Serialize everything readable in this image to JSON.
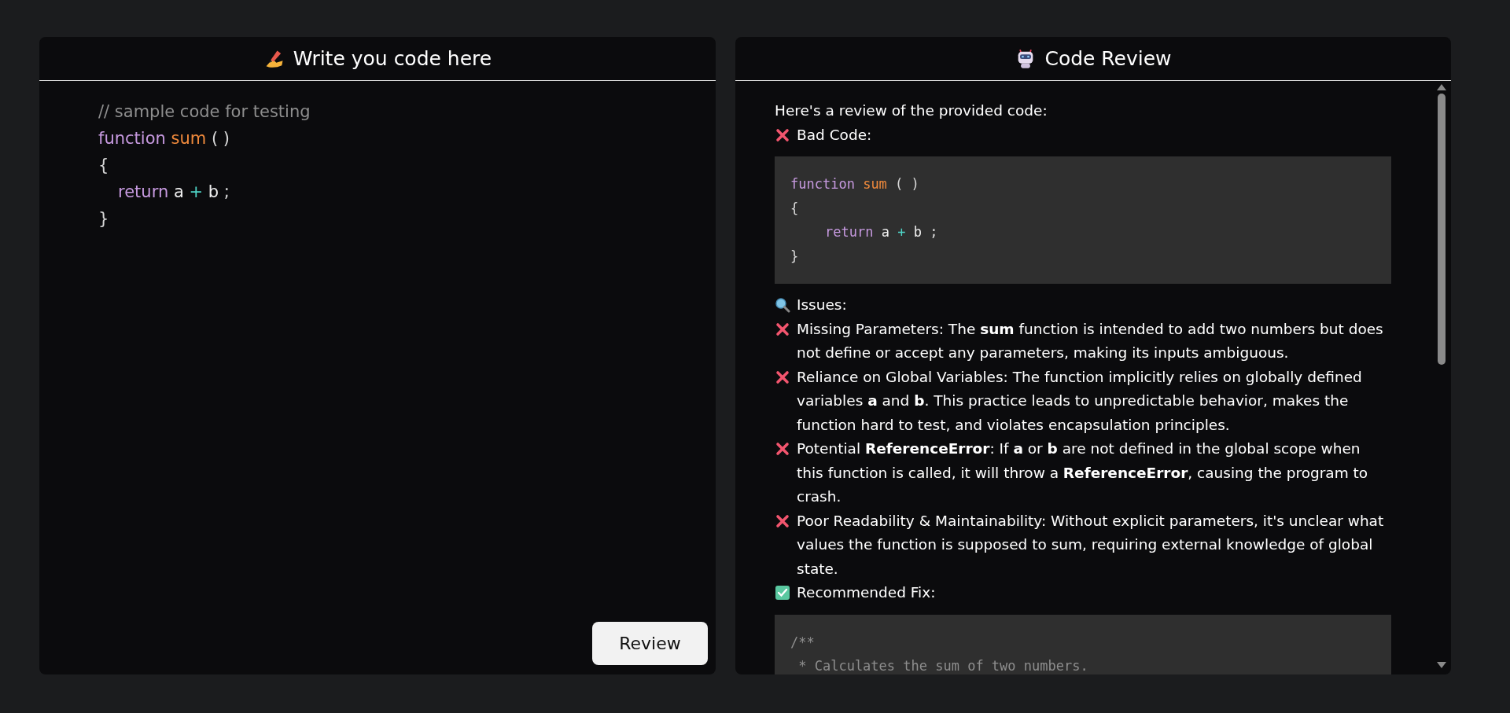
{
  "editor": {
    "title": "Write you code here",
    "lines": [
      {
        "indented": false,
        "tokens": [
          {
            "text": "// sample code for testing",
            "kind": "comment"
          }
        ]
      },
      {
        "indented": false,
        "tokens": [
          {
            "text": "function",
            "kind": "keyword"
          },
          {
            "text": "sum",
            "kind": "function"
          },
          {
            "text": "( )",
            "kind": "punct"
          }
        ]
      },
      {
        "indented": false,
        "tokens": [
          {
            "text": "{",
            "kind": "punct"
          }
        ]
      },
      {
        "indented": true,
        "tokens": [
          {
            "text": "return",
            "kind": "keyword"
          },
          {
            "text": "a",
            "kind": "ident"
          },
          {
            "text": "+",
            "kind": "operator"
          },
          {
            "text": "b",
            "kind": "ident"
          },
          {
            "text": ";",
            "kind": "punct"
          }
        ]
      },
      {
        "indented": false,
        "tokens": [
          {
            "text": "}",
            "kind": "punct"
          }
        ]
      }
    ],
    "button": "Review"
  },
  "review": {
    "title": "Code Review",
    "blocks": [
      {
        "kind": "text",
        "text": "Here's a review of the provided code:"
      },
      {
        "kind": "cross_item",
        "text": "Bad Code:"
      },
      {
        "kind": "code",
        "lines": [
          {
            "indented": false,
            "tokens": [
              {
                "text": "function",
                "kind": "keyword"
              },
              {
                "text": "sum",
                "kind": "function"
              },
              {
                "text": "( )",
                "kind": "punct"
              }
            ]
          },
          {
            "indented": false,
            "tokens": [
              {
                "text": "{",
                "kind": "punct"
              }
            ]
          },
          {
            "indented": true,
            "tokens": [
              {
                "text": "return",
                "kind": "keyword"
              },
              {
                "text": "a",
                "kind": "ident"
              },
              {
                "text": "+",
                "kind": "operator"
              },
              {
                "text": "b",
                "kind": "ident"
              },
              {
                "text": ";",
                "kind": "punct"
              }
            ]
          },
          {
            "indented": false,
            "tokens": [
              {
                "text": "}",
                "kind": "punct"
              }
            ]
          }
        ]
      },
      {
        "kind": "search_item",
        "text": "Issues:"
      },
      {
        "kind": "cross_item",
        "text": "Missing Parameters: The **sum** function is intended to add two numbers but does not define or accept any parameters, making its inputs ambiguous."
      },
      {
        "kind": "cross_item",
        "text": "Reliance on Global Variables: The function implicitly relies on globally defined variables **a** and **b**. This practice leads to unpredictable behavior, makes the function hard to test, and violates encapsulation principles."
      },
      {
        "kind": "cross_item",
        "text": "Potential **ReferenceError**: If **a** or **b** are not defined in the global scope when this function is called, it will throw a **ReferenceError**, causing the program to crash."
      },
      {
        "kind": "cross_item",
        "text": "Poor Readability & Maintainability: Without explicit parameters, it's unclear what values the function is supposed to sum, requiring external knowledge of global state."
      },
      {
        "kind": "check_item",
        "text": "Recommended Fix:"
      },
      {
        "kind": "code",
        "lines": [
          {
            "indented": false,
            "tokens": [
              {
                "text": "/**",
                "kind": "comment"
              }
            ]
          },
          {
            "indented": false,
            "tokens": [
              {
                "text": " * Calculates the sum of two numbers.",
                "kind": "comment"
              }
            ]
          }
        ]
      }
    ]
  }
}
